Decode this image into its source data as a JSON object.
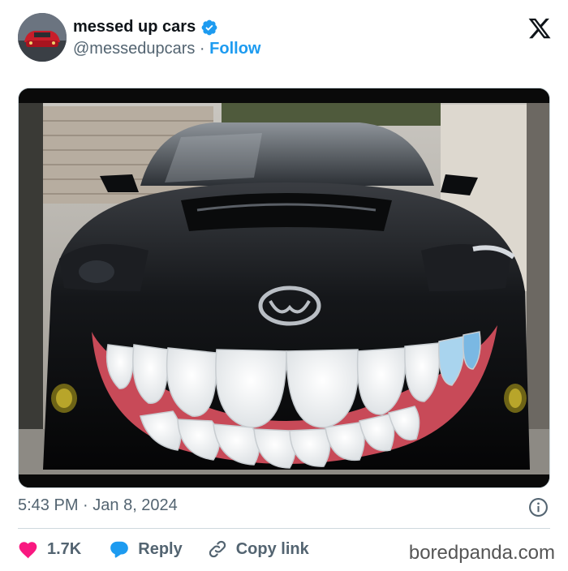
{
  "header": {
    "display_name": "messed up cars",
    "handle": "@messedupcars",
    "separator": " · ",
    "follow_label": "Follow"
  },
  "media": {
    "alt": "Black Mazda car with a giant toothy smile painted on its front grille"
  },
  "footer": {
    "time": "5:43 PM",
    "separator": " · ",
    "date": "Jan 8, 2024"
  },
  "actions": {
    "like_count": "1.7K",
    "reply_label": "Reply",
    "copy_label": "Copy link"
  },
  "watermark": "boredpanda.com",
  "colors": {
    "like": "#f91880",
    "reply": "#1d9bf0",
    "verified": "#1d9bf0",
    "muted": "#536471"
  }
}
